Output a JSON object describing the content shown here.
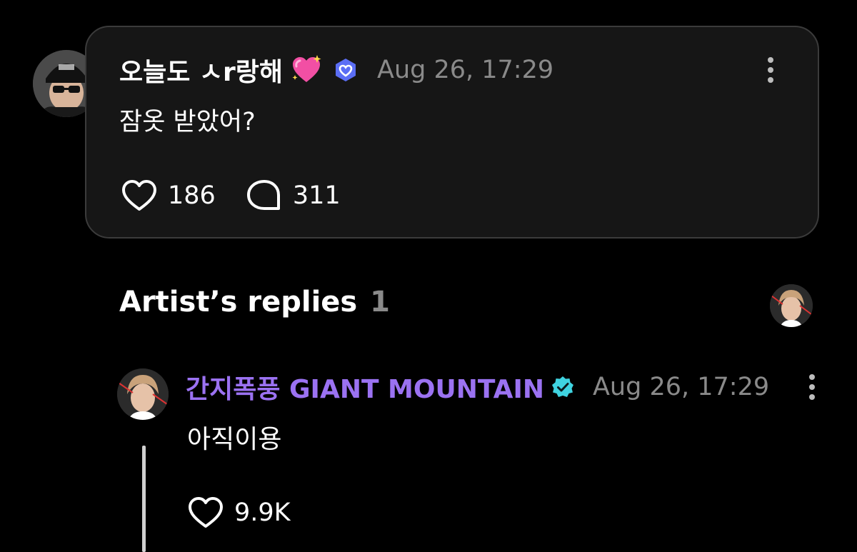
{
  "post": {
    "author": "오늘도 ㅅr랑해",
    "heart_emoji": "sparkling-heart",
    "badge": "membership-badge",
    "time": "Aug 26, 17:29",
    "text": "잠옷 받았어?",
    "likes": "186",
    "comments": "311"
  },
  "replies": {
    "title": "Artist’s replies",
    "count": "1"
  },
  "reply": {
    "author": "간지폭풍 GIANT MOUNTAIN",
    "time": "Aug 26, 17:29",
    "text": "아직이용",
    "likes": "9.9K"
  },
  "colors": {
    "background": "#000000",
    "card": "#161616",
    "card_border": "#3b3b3b",
    "muted": "#8a8a8a",
    "artist_name": "#9b72f2",
    "verified": "#3fd3e0",
    "badge": "#5b6ef5"
  }
}
